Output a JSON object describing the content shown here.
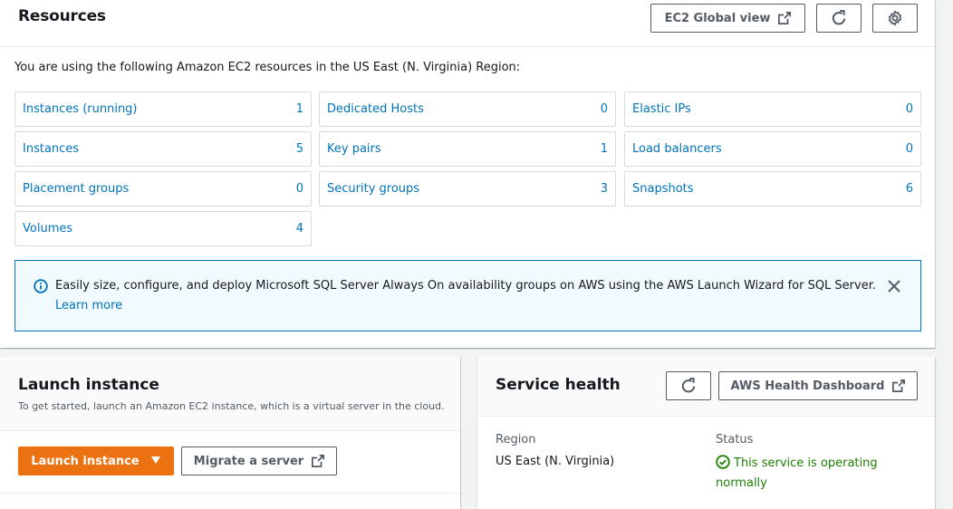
{
  "resources": {
    "title": "Resources",
    "global_view_label": "EC2 Global view",
    "description": "You are using the following Amazon EC2 resources in the US East (N. Virginia) Region:",
    "items": [
      {
        "label": "Instances (running)",
        "count": "1"
      },
      {
        "label": "Dedicated Hosts",
        "count": "0"
      },
      {
        "label": "Elastic IPs",
        "count": "0"
      },
      {
        "label": "Instances",
        "count": "5"
      },
      {
        "label": "Key pairs",
        "count": "1"
      },
      {
        "label": "Load balancers",
        "count": "0"
      },
      {
        "label": "Placement groups",
        "count": "0"
      },
      {
        "label": "Security groups",
        "count": "3"
      },
      {
        "label": "Snapshots",
        "count": "6"
      },
      {
        "label": "Volumes",
        "count": "4"
      }
    ]
  },
  "flash": {
    "message": "Easily size, configure, and deploy Microsoft SQL Server Always On availability groups on AWS using the AWS Launch Wizard for SQL Server.",
    "link": "Learn more"
  },
  "launch": {
    "title": "Launch instance",
    "description": "To get started, launch an Amazon EC2 instance, which is a virtual server in the cloud.",
    "launch_button": "Launch instance",
    "migrate_button": "Migrate a server"
  },
  "health": {
    "title": "Service health",
    "dashboard_button": "AWS Health Dashboard",
    "region_label": "Region",
    "region_value": "US East (N. Virginia)",
    "status_label": "Status",
    "status_value": "This service is operating normally"
  },
  "colors": {
    "link": "#0073bb",
    "primary": "#ec7211",
    "success": "#1d8102",
    "info_bg": "#f1faff"
  },
  "icons": [
    "external-link-icon",
    "refresh-icon",
    "gear-icon",
    "info-icon",
    "close-icon",
    "caret-down-icon",
    "check-circle-icon"
  ]
}
